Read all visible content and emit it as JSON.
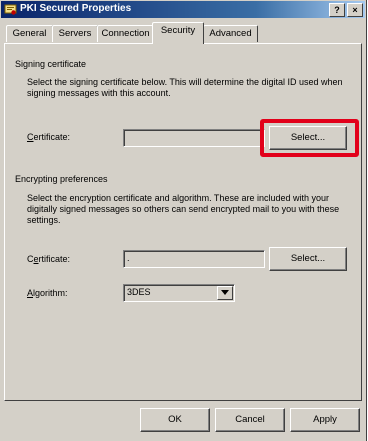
{
  "window": {
    "title": "PKI Secured Properties",
    "help_label": "?",
    "close_label": "×"
  },
  "tabs": [
    "General",
    "Servers",
    "Connection",
    "Security",
    "Advanced"
  ],
  "signing": {
    "heading": "Signing certificate",
    "description": "Select the signing certificate below. This will determine the digital ID used when signing messages with this account.",
    "certificate_label": "Certificate:",
    "certificate_value": "",
    "select_label": "Select..."
  },
  "encrypting": {
    "heading": "Encrypting preferences",
    "description": "Select the encryption certificate and algorithm. These are included with your digitally signed messages so others can send encrypted mail to you with these settings.",
    "certificate_label": "Certificate:",
    "certificate_value": ".",
    "select_label": "Select...",
    "algorithm_label": "Algorithm:",
    "algorithm_value": "3DES"
  },
  "footer": {
    "ok_label": "OK",
    "cancel_label": "Cancel",
    "apply_label": "Apply"
  },
  "colors": {
    "title_start": "#0a246a",
    "title_end": "#a6caf0",
    "face": "#d4d0c8",
    "highlight": "#e2001a"
  },
  "icons": {
    "title": "certificate-icon",
    "combo": "chevron-down-icon"
  }
}
